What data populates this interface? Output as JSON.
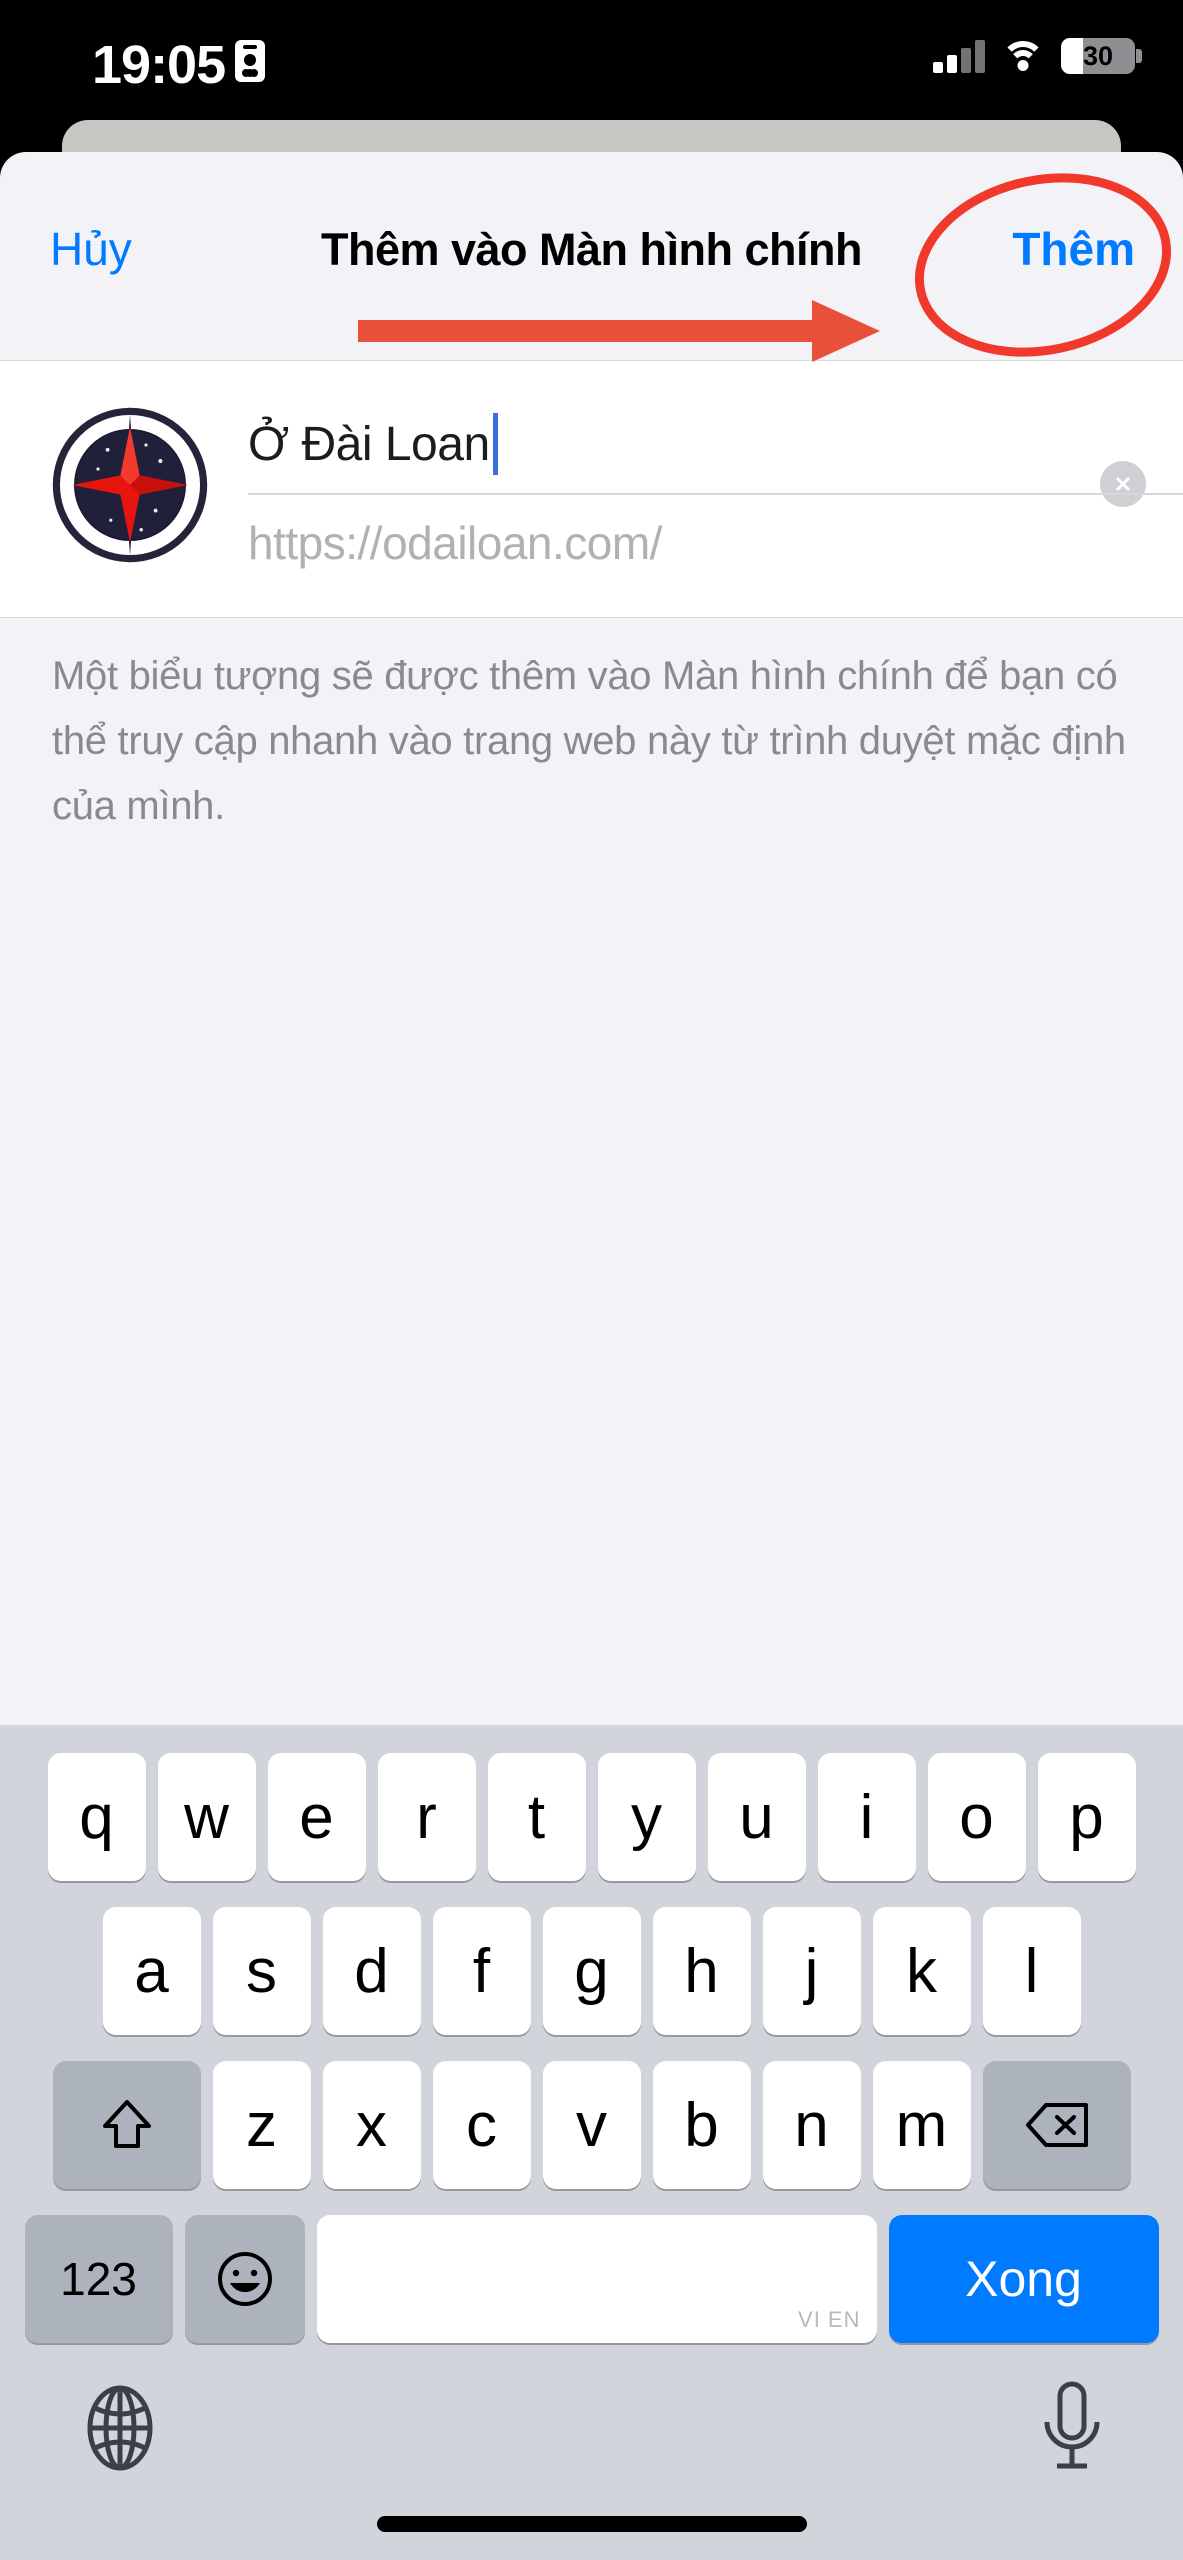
{
  "status_bar": {
    "time": "19:05",
    "lock_icon": "id-card-icon",
    "signal_icon": "cellular-signal-icon",
    "wifi_icon": "wifi-icon",
    "battery_percent": "30",
    "battery_level": 30
  },
  "navbar": {
    "cancel_label": "Hủy",
    "title": "Thêm vào Màn hình chính",
    "add_label": "Thêm"
  },
  "annotations": {
    "arrow_color": "#e8503a",
    "ellipse_color": "#f0392b",
    "arrow_name": "red-arrow-annotation",
    "ellipse_name": "red-ellipse-annotation"
  },
  "form": {
    "favicon_name": "compass-favicon",
    "name_value": "Ở Đài Loan",
    "url_value": "https://odailoan.com/",
    "clear_button_label": "✕"
  },
  "description": {
    "text": "Một biểu tượng sẽ được thêm vào Màn hình chính để bạn có thể truy cập nhanh vào trang web này từ trình duyệt mặc định của mình."
  },
  "keyboard": {
    "row1": [
      "q",
      "w",
      "e",
      "r",
      "t",
      "y",
      "u",
      "i",
      "o",
      "p"
    ],
    "row2": [
      "a",
      "s",
      "d",
      "f",
      "g",
      "h",
      "j",
      "k",
      "l"
    ],
    "row3": [
      "z",
      "x",
      "c",
      "v",
      "b",
      "n",
      "m"
    ],
    "shift_icon": "shift-arrow-icon",
    "delete_icon": "backspace-icon",
    "numbers_label": "123",
    "emoji_icon": "emoji-smiley-icon",
    "space_label": "VI EN",
    "done_label": "Xong",
    "globe_icon": "globe-icon",
    "mic_icon": "microphone-icon"
  },
  "colors": {
    "ios_blue": "#007aff",
    "sheet_bg": "#f2f2f7",
    "keyboard_bg": "#d1d4da",
    "key_white": "#ffffff",
    "key_gray": "#adb3bd"
  }
}
